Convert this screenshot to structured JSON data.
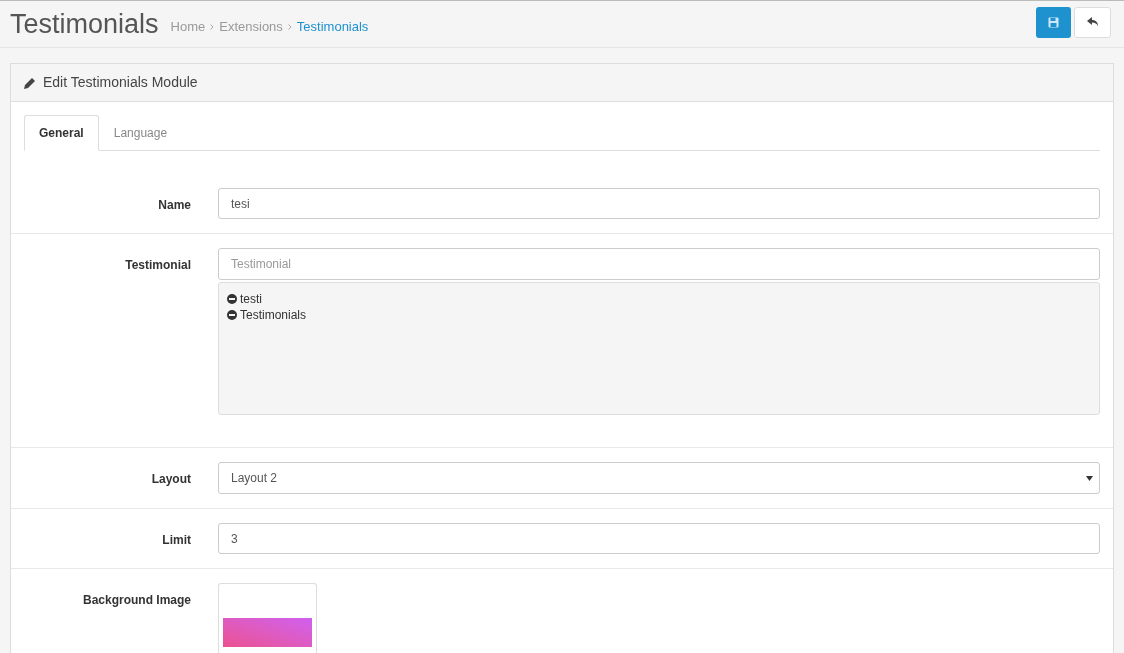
{
  "header": {
    "title": "Testimonials",
    "breadcrumbs": [
      {
        "label": "Home",
        "current": false
      },
      {
        "label": "Extensions",
        "current": false
      },
      {
        "label": "Testimonials",
        "current": true
      }
    ]
  },
  "panel": {
    "title": "Edit Testimonials Module"
  },
  "tabs": [
    {
      "label": "General",
      "selected": true
    },
    {
      "label": "Language",
      "selected": false
    }
  ],
  "fields": [
    {
      "kind": "text",
      "label": "Name",
      "value": "tesi"
    },
    {
      "kind": "tags",
      "label": "Testimonial",
      "placeholder": "Testimonial",
      "items": [
        "testi",
        "Testimonials"
      ]
    },
    {
      "kind": "select",
      "label": "Layout",
      "value": "Layout 2"
    },
    {
      "kind": "text",
      "label": "Limit",
      "value": "3"
    },
    {
      "kind": "image",
      "label": "Background Image"
    }
  ]
}
